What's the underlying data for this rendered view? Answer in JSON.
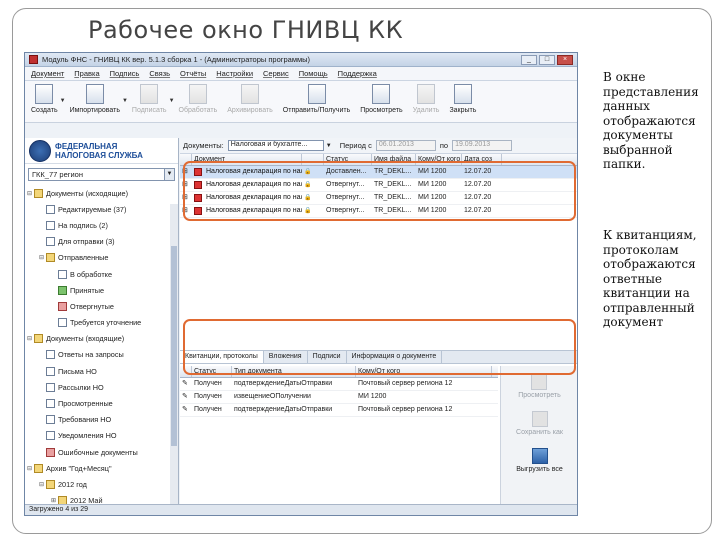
{
  "slide": {
    "title": "Рабочее окно ГНИВЦ КК"
  },
  "window": {
    "title": "Модуль ФНС - ГНИВЦ КК вер. 5.1.3 сборка 1 - (Администраторы программы)",
    "controls": [
      "_",
      "□",
      "×"
    ]
  },
  "menu": [
    "Документ",
    "Правка",
    "Подпись",
    "Связь",
    "Отчёты",
    "Настройки",
    "Сервис",
    "Помощь",
    "Поддержка"
  ],
  "toolbar": [
    {
      "label": "Создать",
      "enabled": true,
      "caret": true,
      "icon": "new-document-icon"
    },
    {
      "label": "Импортировать",
      "enabled": true,
      "caret": true,
      "icon": "import-icon"
    },
    {
      "label": "Подписать",
      "enabled": false,
      "caret": true,
      "icon": "sign-icon"
    },
    {
      "label": "Обработать",
      "enabled": false,
      "caret": false,
      "icon": "process-icon"
    },
    {
      "label": "Архивировать",
      "enabled": false,
      "caret": false,
      "icon": "archive-icon"
    },
    {
      "label": "Отправить/Получить",
      "enabled": true,
      "caret": false,
      "icon": "send-receive-icon"
    },
    {
      "label": "Просмотреть",
      "enabled": true,
      "caret": false,
      "icon": "view-icon"
    },
    {
      "label": "Удалить",
      "enabled": false,
      "caret": false,
      "icon": "delete-icon"
    },
    {
      "label": "Закрыть",
      "enabled": true,
      "caret": false,
      "icon": "close-icon"
    }
  ],
  "sidebar": {
    "logo_line1": "ФЕДЕРАЛЬНАЯ",
    "logo_line2": "НАЛОГОВАЯ СЛУЖБА",
    "region": "ГКК_77 регион",
    "tree": [
      {
        "label": "Документы (исходящие)",
        "indent": 0,
        "exp": "⊟",
        "kind": "folder"
      },
      {
        "label": "Редактируемые (37)",
        "indent": 1,
        "exp": "",
        "kind": "doc"
      },
      {
        "label": "На подпись (2)",
        "indent": 1,
        "exp": "",
        "kind": "doc"
      },
      {
        "label": "Для отправки (3)",
        "indent": 1,
        "exp": "",
        "kind": "doc"
      },
      {
        "label": "Отправленные",
        "indent": 1,
        "exp": "⊟",
        "kind": "folder"
      },
      {
        "label": "В обработке",
        "indent": 2,
        "exp": "",
        "kind": "doc"
      },
      {
        "label": "Принятые",
        "indent": 2,
        "exp": "",
        "kind": "green"
      },
      {
        "label": "Отвергнутые",
        "indent": 2,
        "exp": "",
        "kind": "red"
      },
      {
        "label": "Требуется уточнение",
        "indent": 2,
        "exp": "",
        "kind": "doc"
      },
      {
        "label": "Документы (входящие)",
        "indent": 0,
        "exp": "⊟",
        "kind": "folder"
      },
      {
        "label": "Ответы на запросы",
        "indent": 1,
        "exp": "",
        "kind": "doc"
      },
      {
        "label": "Письма НО",
        "indent": 1,
        "exp": "",
        "kind": "doc"
      },
      {
        "label": "Рассылки НО",
        "indent": 1,
        "exp": "",
        "kind": "doc"
      },
      {
        "label": "Просмотренные",
        "indent": 1,
        "exp": "",
        "kind": "doc"
      },
      {
        "label": "Требования НО",
        "indent": 1,
        "exp": "",
        "kind": "doc"
      },
      {
        "label": "Уведомления НО",
        "indent": 1,
        "exp": "",
        "kind": "doc"
      },
      {
        "label": "Ошибочные документы",
        "indent": 1,
        "exp": "",
        "kind": "red"
      },
      {
        "label": "Архив \"Год+Месяц\"",
        "indent": 0,
        "exp": "⊟",
        "kind": "folder"
      },
      {
        "label": "2012 год",
        "indent": 1,
        "exp": "⊟",
        "kind": "folder"
      },
      {
        "label": "2012 Май",
        "indent": 2,
        "exp": "⊞",
        "kind": "folder"
      }
    ]
  },
  "filter": {
    "docs_label": "Документы:",
    "docs_value": "Налоговая и бухгалте...",
    "period_label": "Период с",
    "date_from": "06.01.2013",
    "to_label": "по",
    "date_to": "19.09.2013"
  },
  "docs_table": {
    "columns": [
      "Документ",
      "",
      "Статус",
      "Имя файла",
      "Кому/От кого",
      "Дата соз"
    ],
    "rows": [
      [
        "Налоговая декларация по нал...",
        "",
        "Доставлен...",
        "TR_DEKL...",
        "МИ 1200",
        "12.07.20"
      ],
      [
        "Налоговая декларация по нал...",
        "",
        "Отвергнут...",
        "TR_DEKL...",
        "МИ 1200",
        "12.07.20"
      ],
      [
        "Налоговая декларация по нал...",
        "",
        "Отвергнут...",
        "TR_DEKL...",
        "МИ 1200",
        "12.07.20"
      ],
      [
        "Налоговая декларация по нал...",
        "",
        "Отвергнут...",
        "TR_DEKL...",
        "МИ 1200",
        "12.07.20"
      ]
    ]
  },
  "lower_tabs": [
    "Квитанции, протоколы",
    "Вложения",
    "Подписи",
    "Информация о документе"
  ],
  "receipts_table": {
    "columns": [
      "Статус",
      "Тип документа",
      "Кому/От кого"
    ],
    "rows": [
      [
        "Получен",
        "подтверждениеДатыОтправки",
        "Почтовый сервер региона 12"
      ],
      [
        "Получен",
        "извещениеОПолучении",
        "МИ 1200"
      ],
      [
        "Получен",
        "подтверждениеДатыОтправки",
        "Почтовый сервер региона 12"
      ]
    ]
  },
  "side_actions": [
    {
      "label": "Просмотреть",
      "enabled": false
    },
    {
      "label": "Сохранить как",
      "enabled": false
    },
    {
      "label": "Выгрузить все",
      "enabled": true
    }
  ],
  "status_bar": "Загружено 4 из 29",
  "notes": [
    "В окне представления данных отображаются документы выбранной папки.",
    "К квитанциям, протоколам отображаются ответные квитанции на отправленный документ"
  ],
  "colors": {
    "highlight": "#e06a32",
    "selected_row": "#cfe0f6",
    "accent": "#1d4e99"
  }
}
